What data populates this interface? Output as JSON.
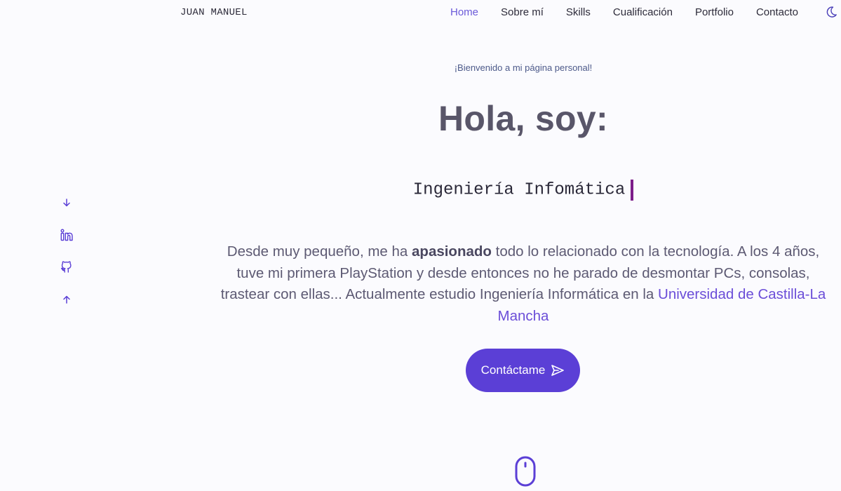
{
  "header": {
    "logo": "JUAN MANUEL",
    "nav": [
      {
        "label": "Home",
        "active": true
      },
      {
        "label": "Sobre mí",
        "active": false
      },
      {
        "label": "Skills",
        "active": false
      },
      {
        "label": "Cualificación",
        "active": false
      },
      {
        "label": "Portfolio",
        "active": false
      },
      {
        "label": "Contacto",
        "active": false
      }
    ],
    "theme_icon": "moon-icon"
  },
  "social": {
    "items": [
      "arrow-down-icon",
      "linkedin-icon",
      "github-icon",
      "arrow-up-icon"
    ]
  },
  "hero": {
    "welcome": "¡Bienvenido a mi página personal!",
    "title": "Hola, soy:",
    "typed_text": "Ingeniería Infomática",
    "description_before": "Desde muy pequeño, me ha ",
    "description_bold": "apasionado",
    "description_after": " todo lo relacionado con la tecnología. A los 4 años, tuve mi primera PlayStation y desde entonces no he parado de desmontar PCs, consolas, trastear con ellas... Actualmente estudio Ingeniería Informática en la ",
    "description_link": "Universidad de Castilla-La Mancha",
    "cta_label": "Contáctame",
    "cta_icon": "send-icon",
    "scroll_icon": "mouse-icon"
  },
  "colors": {
    "accent": "#5b3fd6",
    "link": "#6b4ed8",
    "caret": "#7c1d8a",
    "background": "#fbfbfe"
  }
}
